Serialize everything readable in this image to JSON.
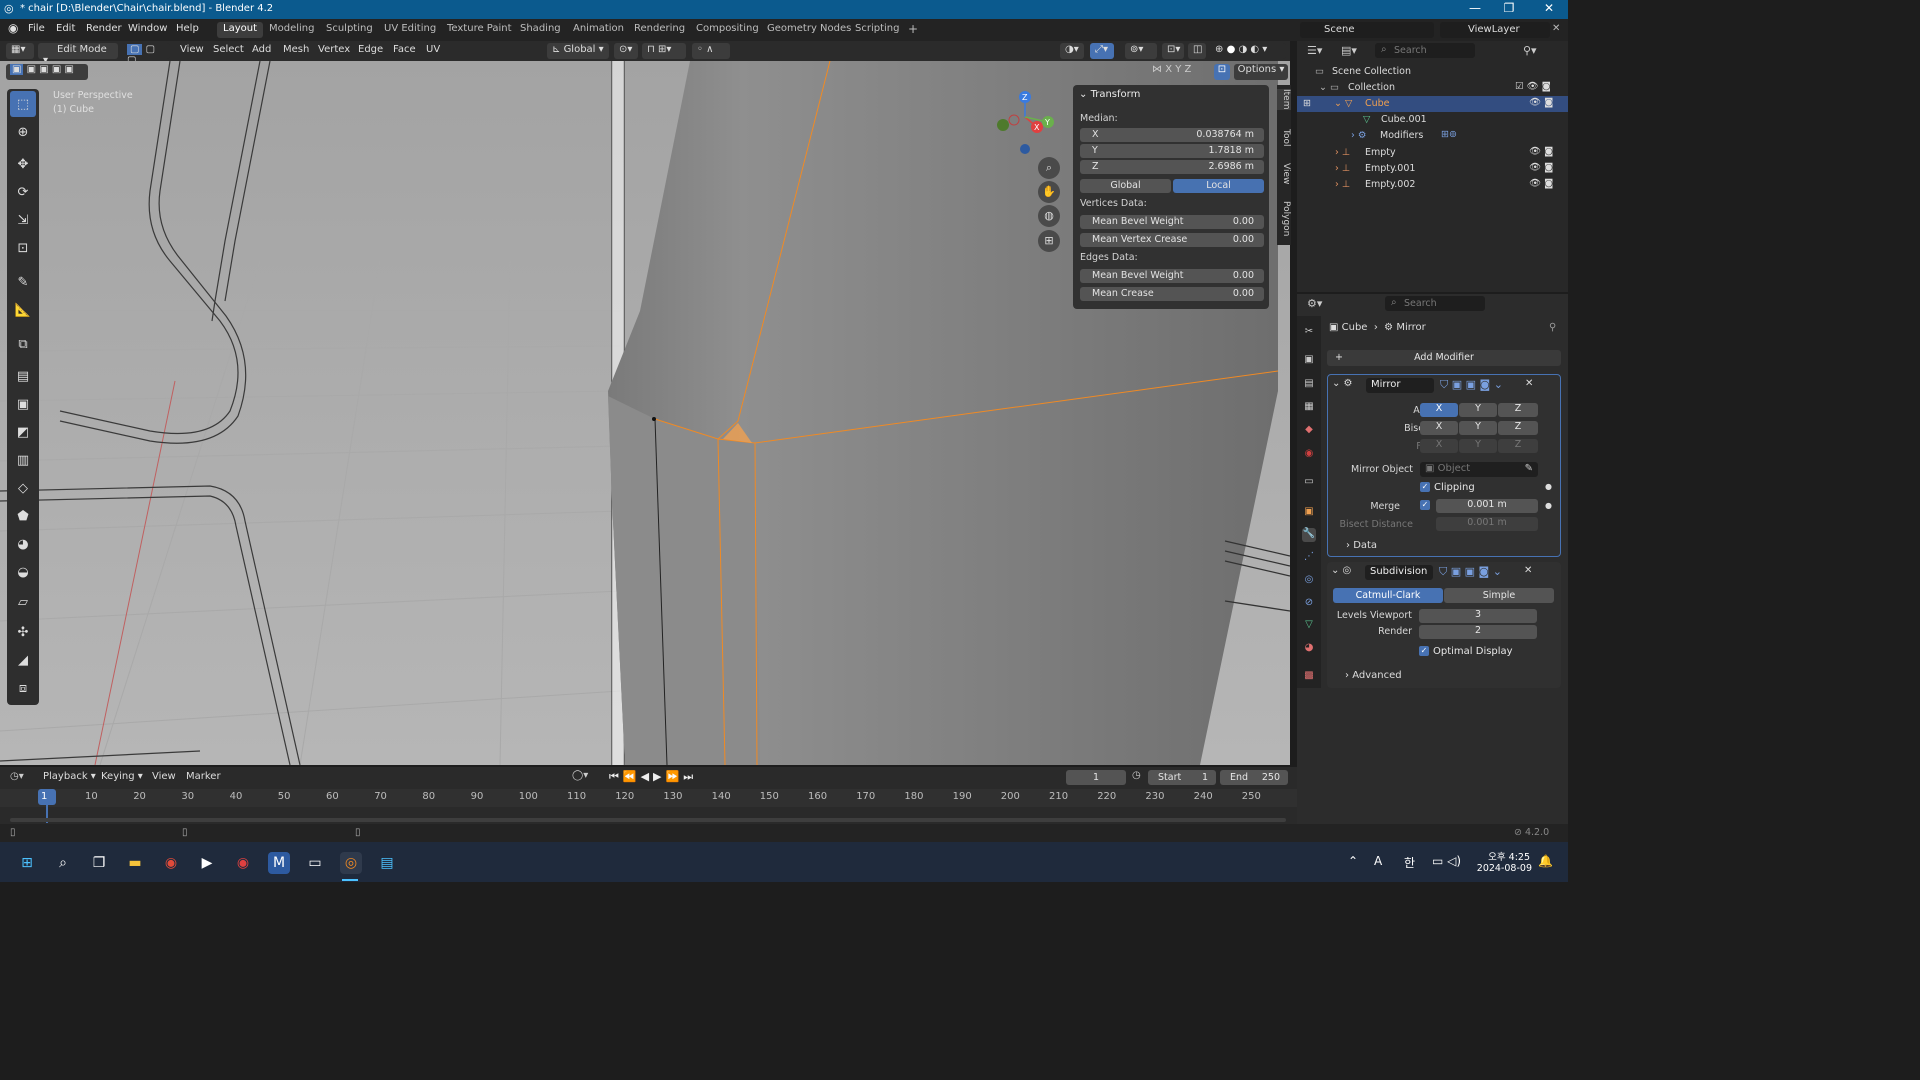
{
  "window": {
    "title": "* chair [D:\\Blender\\Chair\\chair.blend] - Blender 4.2"
  },
  "topmenu": [
    "File",
    "Edit",
    "Render",
    "Window",
    "Help"
  ],
  "workspaces": [
    "Layout",
    "Modeling",
    "Sculpting",
    "UV Editing",
    "Texture Paint",
    "Shading",
    "Animation",
    "Rendering",
    "Compositing",
    "Geometry Nodes",
    "Scripting"
  ],
  "scene": {
    "scene_name": "Scene",
    "view_layer": "ViewLayer"
  },
  "header3d": {
    "mode": "Edit Mode",
    "menus": [
      "View",
      "Select",
      "Add",
      "Mesh",
      "Vertex",
      "Edge",
      "Face",
      "UV"
    ],
    "orientation": "Global",
    "options": "Options",
    "axes": [
      "X",
      "Y",
      "Z"
    ]
  },
  "viewport": {
    "perspective": "User Perspective",
    "object": "(1) Cube"
  },
  "npanel": {
    "title": "Transform",
    "median_label": "Median:",
    "x_label": "X",
    "x": "0.038764 m",
    "y_label": "Y",
    "y": "1.7818 m",
    "z_label": "Z",
    "z": "2.6986 m",
    "global": "Global",
    "local": "Local",
    "vertices_label": "Vertices Data:",
    "v_bevel_label": "Mean Bevel Weight",
    "v_bevel": "0.00",
    "v_crease_label": "Mean Vertex Crease",
    "v_crease": "0.00",
    "edges_label": "Edges Data:",
    "e_bevel_label": "Mean Bevel Weight",
    "e_bevel": "0.00",
    "e_crease_label": "Mean Crease",
    "e_crease": "0.00",
    "tabs": [
      "Item",
      "Tool",
      "View",
      "Polygon"
    ]
  },
  "outliner": {
    "search": "Search",
    "rows": [
      "Scene Collection",
      "Collection",
      "Cube",
      "Cube.001",
      "Modifiers",
      "Empty",
      "Empty.001",
      "Empty.002"
    ]
  },
  "properties": {
    "search": "Search",
    "breadcrumb_obj": "Cube",
    "breadcrumb_mod": "Mirror",
    "add_modifier": "Add Modifier",
    "mirror": {
      "name": "Mirror",
      "axis_label": "Axis",
      "bisect_label": "Bisect",
      "flip_label": "Flip",
      "x": "X",
      "y": "Y",
      "z": "Z",
      "mirror_object_label": "Mirror Object",
      "object_placeholder": "Object",
      "clipping": "Clipping",
      "merge_label": "Merge",
      "merge": "0.001 m",
      "bisect_distance_label": "Bisect Distance",
      "bisect_distance": "0.001 m",
      "data": "Data"
    },
    "subdivision": {
      "name": "Subdivision",
      "catmull": "Catmull-Clark",
      "simple": "Simple",
      "levels_label": "Levels Viewport",
      "levels": "3",
      "render_label": "Render",
      "render": "2",
      "optimal": "Optimal Display",
      "advanced": "Advanced"
    }
  },
  "timeline": {
    "menus": [
      "Playback",
      "Keying",
      "View",
      "Marker"
    ],
    "current": "1",
    "start_label": "Start",
    "start": "1",
    "end_label": "End",
    "end": "250",
    "ticks": [
      "1",
      "10",
      "20",
      "30",
      "40",
      "50",
      "60",
      "70",
      "80",
      "90",
      "100",
      "110",
      "120",
      "130",
      "140",
      "150",
      "160",
      "170",
      "180",
      "190",
      "200",
      "210",
      "220",
      "230",
      "240",
      "250"
    ]
  },
  "status": {
    "version": "4.2.0"
  },
  "taskbar": {
    "ampm_time": "오후 4:25",
    "date": "2024-08-09",
    "lang1": "A",
    "lang2": "한"
  },
  "colors": {
    "accent": "#4772b3",
    "selection_orange": "#f08a24",
    "title_blue": "#0b5a8e"
  }
}
